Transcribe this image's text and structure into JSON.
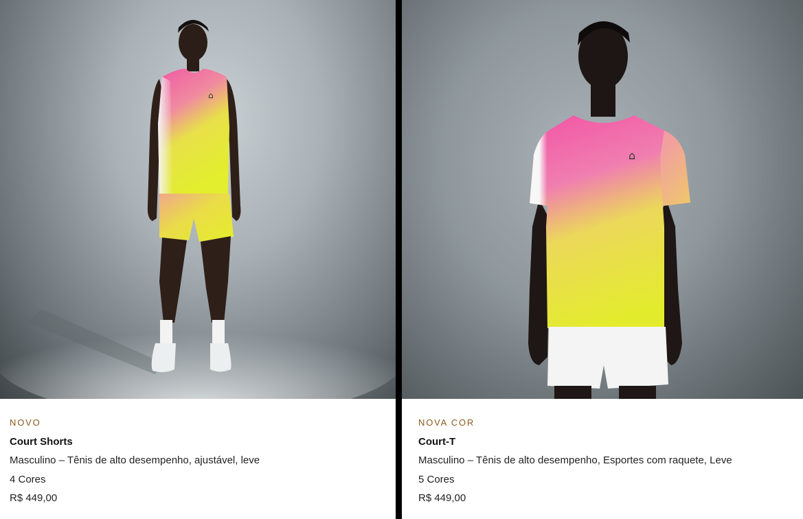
{
  "products": [
    {
      "badge": "NOVO",
      "name": "Court Shorts",
      "description": "Masculino – Tênis de alto desempenho, ajustável, leve",
      "colors": "4 Cores",
      "price": "R$ 449,00",
      "image_icon": "model-full-body-photo",
      "logo_text": "On"
    },
    {
      "badge": "NOVA COR",
      "name": "Court-T",
      "description": "Masculino – Tênis de alto desempenho, Esportes com raquete, Leve",
      "colors": "5 Cores",
      "price": "R$ 449,00",
      "image_icon": "model-torso-photo",
      "logo_text": "On"
    }
  ],
  "palette": {
    "badge": "#8a5a1e",
    "gradient_pink": "#f06aa8",
    "gradient_yellow": "#e6ee3a",
    "divider": "#000000"
  }
}
